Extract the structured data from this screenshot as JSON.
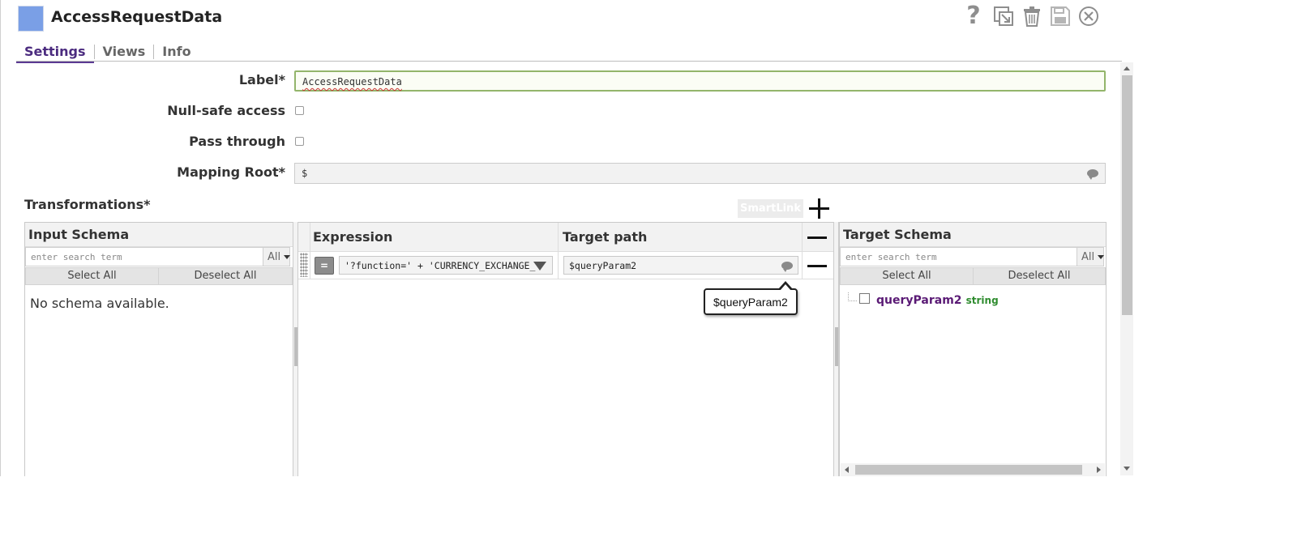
{
  "header": {
    "title": "AccessRequestData",
    "icons": [
      "help-icon",
      "export-icon",
      "trash-icon",
      "save-icon",
      "close-icon"
    ]
  },
  "tabs": [
    {
      "label": "Settings",
      "active": true
    },
    {
      "label": "Views",
      "active": false
    },
    {
      "label": "Info",
      "active": false
    }
  ],
  "form": {
    "label_label": "Label*",
    "label_value": "AccessRequestData",
    "null_safe_label": "Null-safe access",
    "null_safe_checked": false,
    "pass_through_label": "Pass through",
    "pass_through_checked": false,
    "mapping_root_label": "Mapping Root*",
    "mapping_root_value": "$"
  },
  "transformations": {
    "title": "Transformations*",
    "smartlink_label": "SmartLink",
    "input_schema": {
      "title": "Input Schema",
      "search_placeholder": "enter search term",
      "filter_value": "All",
      "select_all": "Select All",
      "deselect_all": "Deselect All",
      "empty_message": "No schema available."
    },
    "mapping_table": {
      "expression_header": "Expression",
      "target_path_header": "Target path",
      "rows": [
        {
          "mode_button": "=",
          "expression": "'?function=' + 'CURRENCY_EXCHANGE_",
          "target_path": "$queryParam2"
        }
      ],
      "tooltip": "$queryParam2"
    },
    "target_schema": {
      "title": "Target Schema",
      "search_placeholder": "enter search term",
      "filter_value": "All",
      "select_all": "Select All",
      "deselect_all": "Deselect All",
      "fields": [
        {
          "name": "queryParam2",
          "type": "string"
        }
      ]
    }
  },
  "colors": {
    "accent": "#5b3a93",
    "snap_square": "#7a9fe6",
    "label_border": "#93b56b",
    "field_name": "#5a1a75",
    "field_type": "#2e8b2e"
  }
}
